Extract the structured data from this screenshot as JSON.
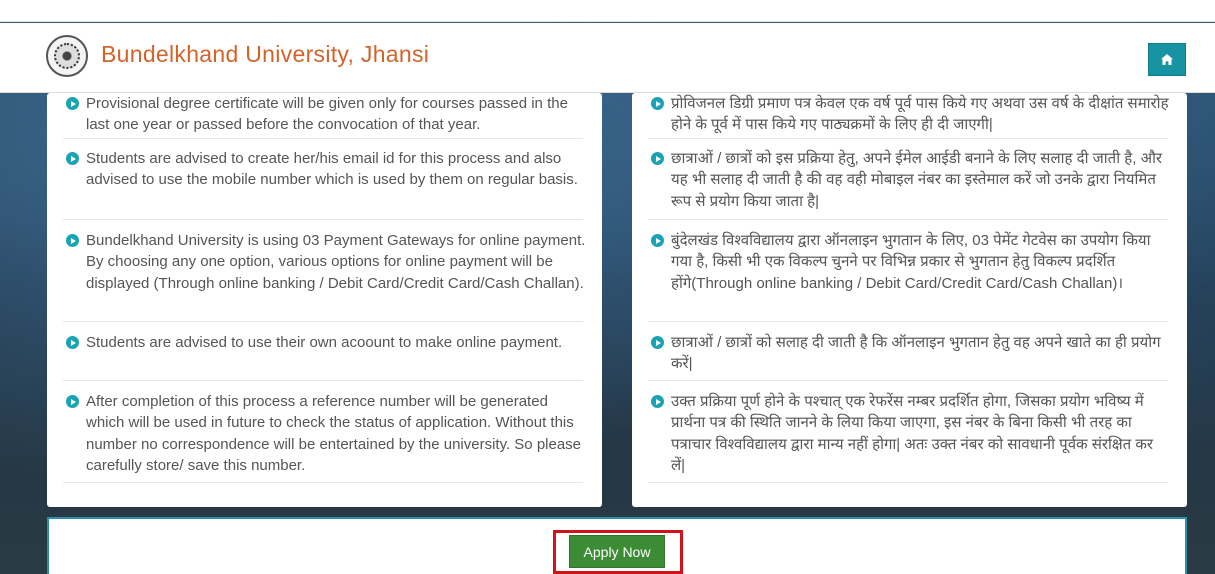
{
  "header": {
    "title": "Bundelkhand University, Jhansi",
    "logo_icon": "university-seal-icon",
    "home_icon": "home-icon",
    "accent_color": "#1793a3",
    "title_color": "#d2632b"
  },
  "instructions_en": [
    "Provisional degree certificate will be given only for courses passed in the last one year or passed before the convocation of that year.",
    "Students are advised to create her/his email id for this process and also advised to use the mobile number which is used by them on regular basis.",
    "Bundelkhand University is using 03 Payment Gateways for online payment. By choosing any one option, various options for online payment will be displayed (Through online banking / Debit Card/Credit Card/Cash Challan).",
    "Students are advised to use their own acoount to make online payment.",
    "After completion of this process a reference number will be generated which will be used in future to check the status of application. Without this number no correspondence will be entertained by the university. So please carefully store/ save this number."
  ],
  "instructions_hi": [
    "प्रोविजनल डिग्री प्रमाण पत्र केवल एक वर्ष पूर्व पास किये गए अथवा उस वर्ष के दीक्षांत समारोह होने के पूर्व में पास किये गए पाठ्यक्रमों के लिए ही दी जाएगी|",
    "छात्राओं / छात्रों को इस प्रक्रिया हेतु, अपने ईमेल आईडी बनाने के लिए सलाह दी जाती है, और यह भी सलाह दी जाती है की वह वही मोबाइल नंबर का इस्तेमाल करें जो उनके द्वारा नियमित रूप से प्रयोग किया जाता है|",
    "बुंदेलखंड विश्वविद्यालय द्वारा ऑनलाइन भुगतान के लिए, 03 पेमेंट गेटवेस का उपयोग किया गया है, किसी भी एक विकल्प चुनने पर विभिन्न प्रकार से भुगतान हेतु विकल्प प्रदर्शित होंगे(Through online banking / Debit Card/Credit Card/Cash Challan)।",
    "छात्राओं / छात्रों को सलाह दी जाती है कि ऑनलाइन भुगतान हेतु वह अपने खाते का ही प्रयोग करें|",
    "उक्त प्रक्रिया पूर्ण होने के पश्चात् एक रेफरेंस नम्बर प्रदर्शित होगा, जिसका प्रयोग भविष्य में प्रार्थना पत्र की स्थिति जानने के लिया किया जाएगा, इस नंबर के बिना किसी भी तरह का पत्राचार विश्वविद्यालय द्वारा मान्य नहीं होगा| अतः उक्त नंबर को सावधानी पूर्वक संरक्षित कर लें|"
  ],
  "bullet_icon": "arrow-circle-right-icon",
  "apply": {
    "label": "Apply Now",
    "button_color": "#3b8c34",
    "highlight_color": "#d0121b"
  }
}
